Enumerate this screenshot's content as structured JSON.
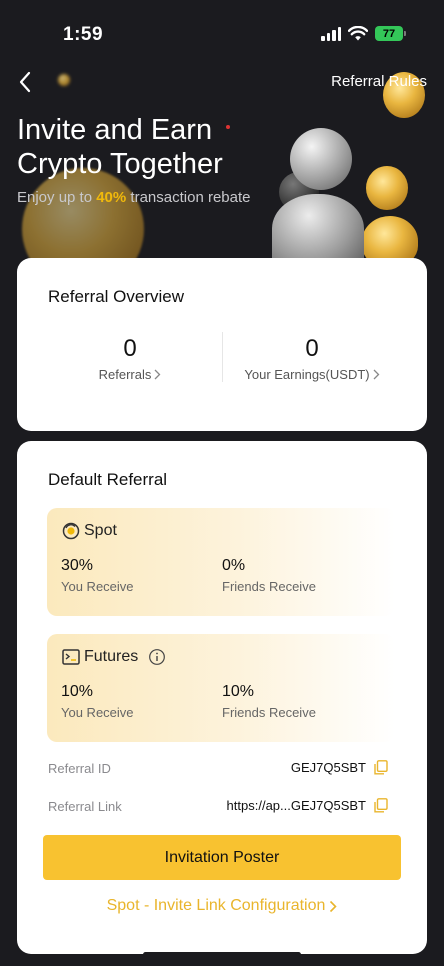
{
  "status": {
    "time": "1:59",
    "battery": "77"
  },
  "header": {
    "rules_label": "Referral Rules"
  },
  "hero": {
    "title_line1": "Invite and Earn",
    "title_line2": "Crypto Together",
    "sub_prefix": "Enjoy up to ",
    "sub_highlight": "40%",
    "sub_suffix": " transaction rebate"
  },
  "overview": {
    "title": "Referral Overview",
    "referrals_value": "0",
    "referrals_label": "Referrals",
    "earnings_value": "0",
    "earnings_label": "Your Earnings(USDT)"
  },
  "default_referral": {
    "title": "Default Referral",
    "spot": {
      "name": "Spot",
      "you_pct": "30%",
      "you_label": "You Receive",
      "friends_pct": "0%",
      "friends_label": "Friends Receive"
    },
    "futures": {
      "name": "Futures",
      "you_pct": "10%",
      "you_label": "You Receive",
      "friends_pct": "10%",
      "friends_label": "Friends Receive"
    },
    "referral_id_label": "Referral ID",
    "referral_id_value": "GEJ7Q5SBT",
    "referral_link_label": "Referral Link",
    "referral_link_value": "https://ap...GEJ7Q5SBT",
    "poster_button": "Invitation Poster",
    "config_link": "Spot - Invite Link Configuration"
  },
  "colors": {
    "accent": "#f8c230",
    "background": "#1b1b1f",
    "link": "#e9b52c",
    "battery": "#34c759"
  }
}
